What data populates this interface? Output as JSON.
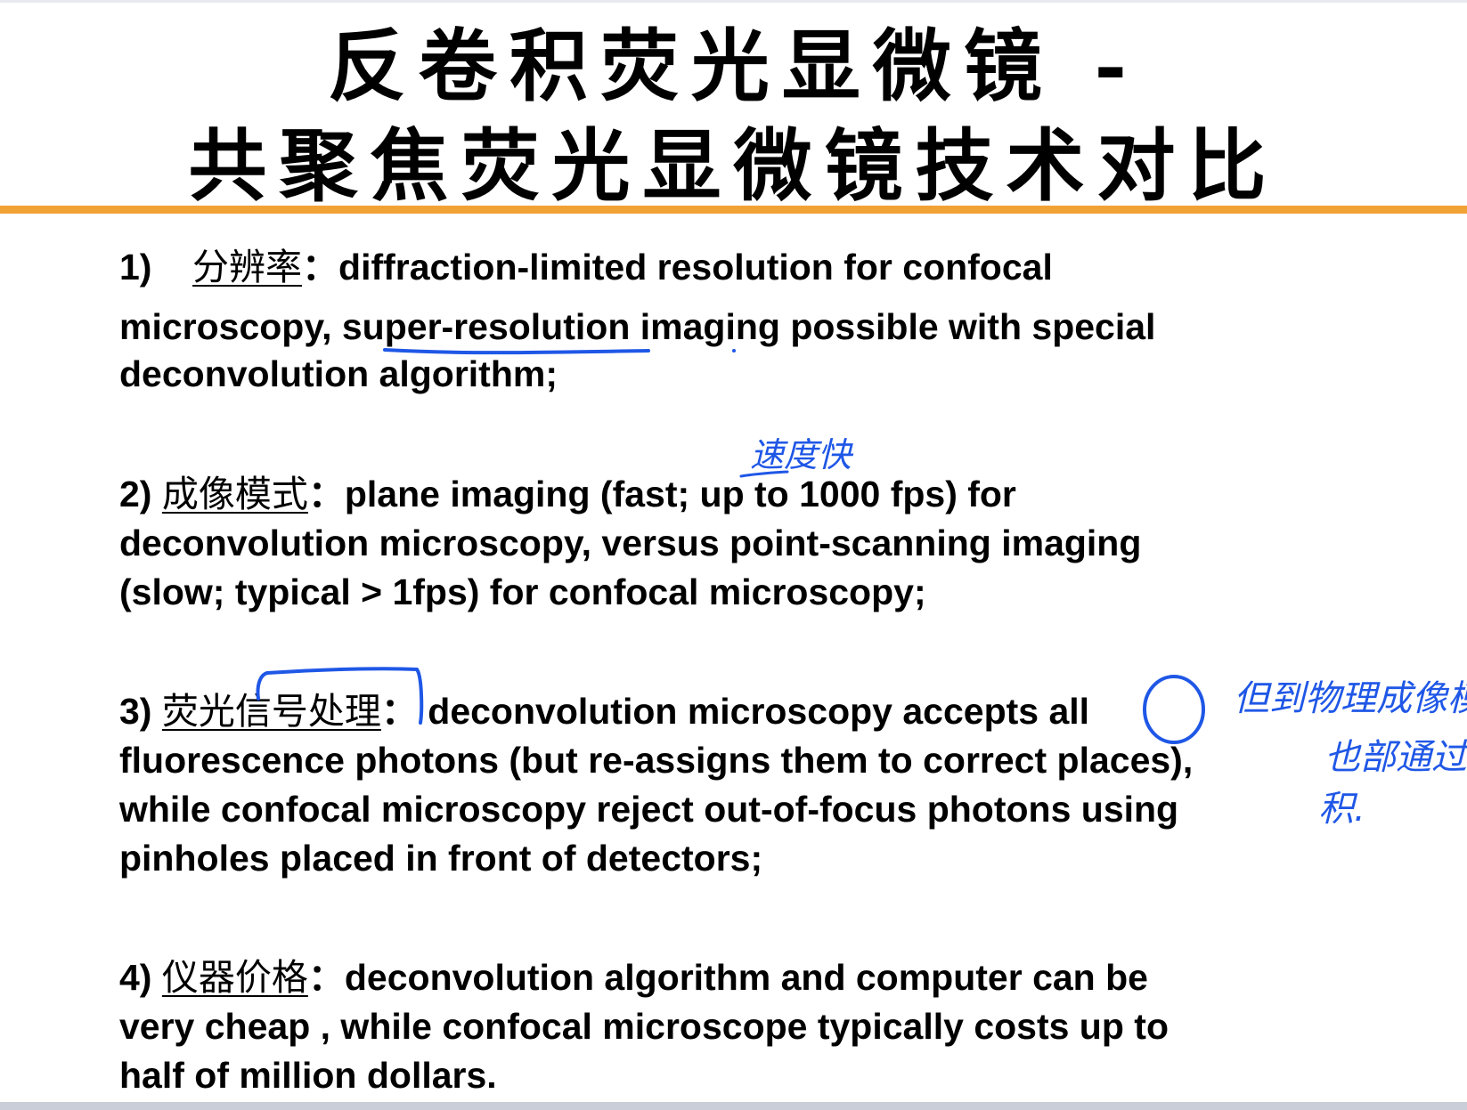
{
  "title": {
    "line1": "反卷积荧光显微镜 -",
    "line2": "共聚焦荧光显微镜技术对比"
  },
  "points": [
    {
      "num": "1)",
      "heading": "分辨率",
      "sep": "：",
      "lines": [
        "diffraction-limited resolution for confocal",
        "microscopy, super-resolution imaging possible with special",
        "deconvolution algorithm;"
      ]
    },
    {
      "num": "2)",
      "heading": "成像模式",
      "sep": "：",
      "lines": [
        "plane imaging (fast; up to 1000 fps) for",
        "deconvolution microscopy, versus point-scanning imaging",
        "(slow; typical > 1fps) for confocal microscopy;"
      ]
    },
    {
      "num": "3)",
      "heading": "荧光信号处理",
      "sep": "：",
      "lines": [
        "deconvolution microscopy accepts all",
        "fluorescence photons (but re-assigns them to correct places),",
        "while confocal microscopy reject out-of-focus photons using",
        "pinholes placed in front of detectors;"
      ]
    },
    {
      "num": "4)",
      "heading": "仪器价格",
      "sep": "：",
      "lines": [
        "deconvolution algorithm and computer can be",
        "very cheap , while confocal microscope typically costs up to",
        "half of million dollars."
      ]
    }
  ],
  "annotations": {
    "note_fast": "速度快",
    "note_all_1": "但到物理成像模糊",
    "note_all_2": "也部通过反卷",
    "note_all_3": "积."
  },
  "colors": {
    "accent_rule": "#f0a235",
    "ink": "#1f57e6"
  }
}
